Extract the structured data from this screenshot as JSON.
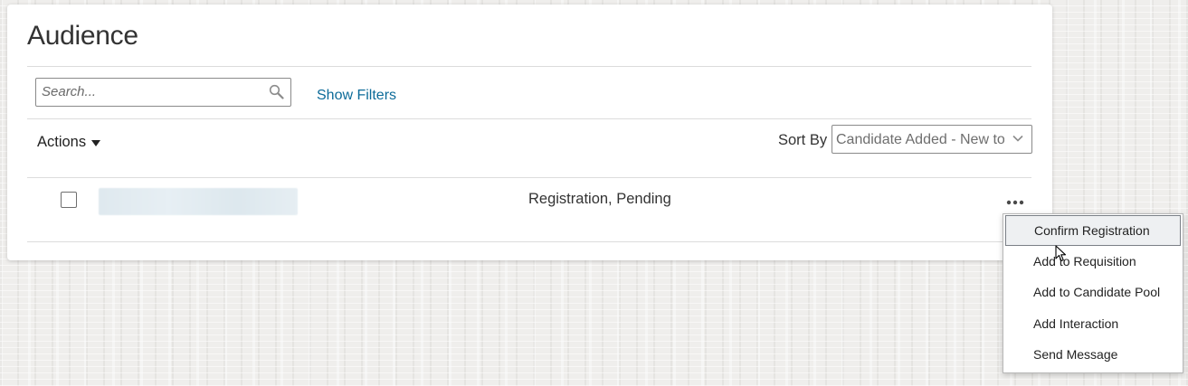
{
  "page": {
    "title": "Audience"
  },
  "toolbar": {
    "search_placeholder": "Search...",
    "search_icon": "magnifier-icon",
    "show_filters_label": "Show Filters",
    "actions_label": "Actions",
    "sort_by_label": "Sort By",
    "sort_by_value": "Candidate Added - New to Old"
  },
  "rows": [
    {
      "checked": false,
      "name": "",
      "status": "Registration, Pending"
    }
  ],
  "context_menu": {
    "items": [
      {
        "label": "Confirm Registration",
        "highlighted": true
      },
      {
        "label": "Add to Requisition",
        "highlighted": false
      },
      {
        "label": "Add to Candidate Pool",
        "highlighted": false
      },
      {
        "label": "Add Interaction",
        "highlighted": false
      },
      {
        "label": "Send Message",
        "highlighted": false
      }
    ]
  },
  "colors": {
    "link": "#0c6b99",
    "text": "#333333",
    "border": "#8a8a8a",
    "menu_highlight": "#eef0f2"
  }
}
